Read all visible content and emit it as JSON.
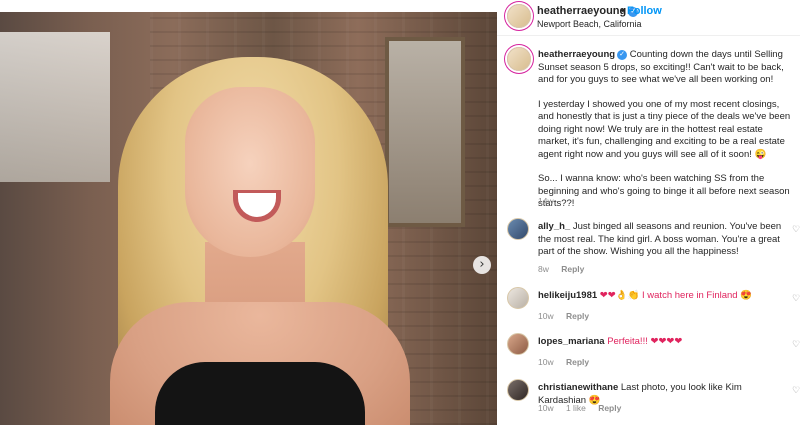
{
  "post": {
    "username": "heatherraeyoung",
    "follow_label": "Follow",
    "separator": "•",
    "location": "Newport Beach, California",
    "caption_intro": "Counting down the days until Selling Sunset season 5 drops, so exciting!! Can't wait to be back, and for you guys to see what we've all been working on!",
    "caption_p2": "I yesterday I showed you one of my most recent closings, and honestly that is just a tiny piece of the deals we've been doing right now! We truly are in the hottest real estate market, it's fun, challenging and exciting to be a real estate agent right now and you guys will see all of it soon! 😜",
    "caption_p3": "So... I wanna know: who's been watching SS from the beginning and who's going to binge it all before next season starts??!",
    "time": "14w"
  },
  "photo": {
    "next_icon": "chevron-right-icon"
  },
  "comments": [
    {
      "username": "ally_h_",
      "text": "Just binged all seasons and reunion. You've been the most real. The kind girl. A boss woman. You're a great part of the show. Wishing you all the happiness!",
      "time": "8w",
      "reply": "Reply"
    },
    {
      "username": "helikeiju1981",
      "text": "❤❤👌👏 I watch here in Finland 😍",
      "time": "10w",
      "reply": "Reply"
    },
    {
      "username": "lopes_mariana",
      "text": "Perfeita!!! ❤❤❤❤",
      "time": "10w",
      "reply": "Reply"
    },
    {
      "username": "christianewithane",
      "text": "Last photo, you look like Kim Kardashian 😍",
      "time": "10w",
      "likes": "1 like",
      "reply": "Reply"
    }
  ],
  "colors": {
    "accent": "#0095f6",
    "muted": "#8e8e8e",
    "verified": "#3897f0"
  }
}
